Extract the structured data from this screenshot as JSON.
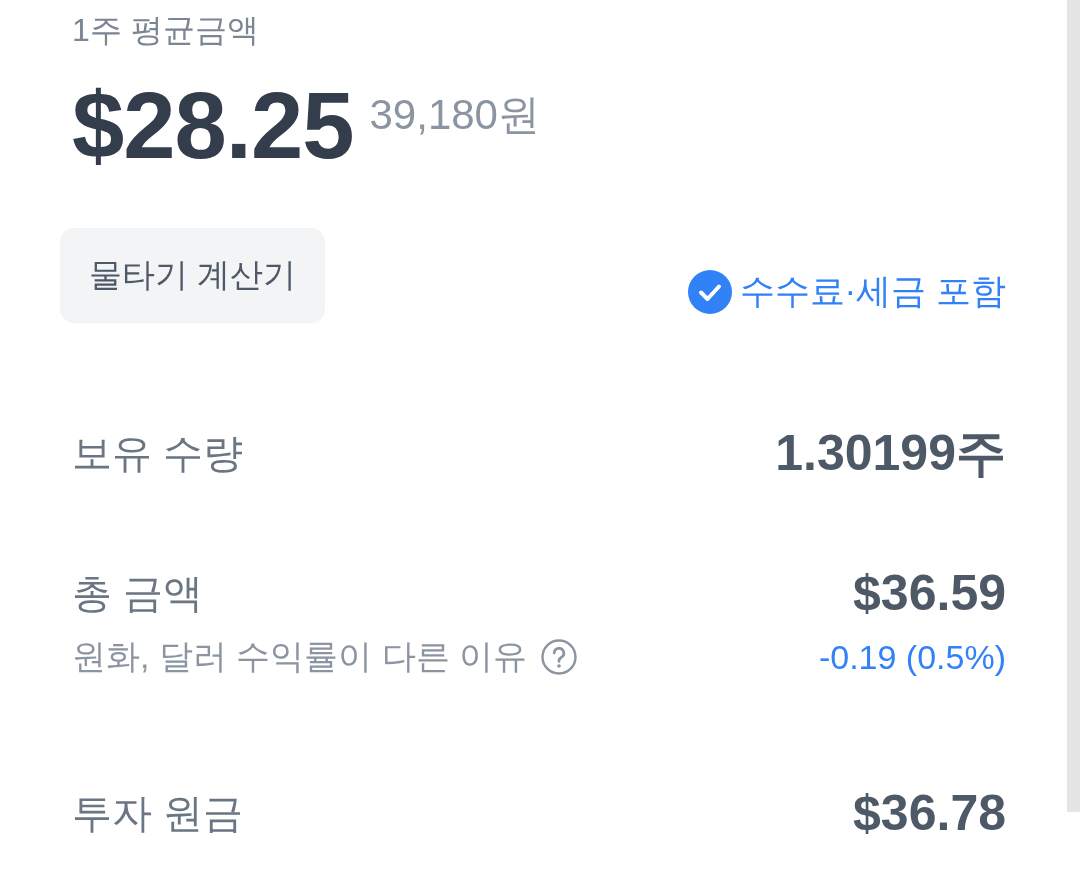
{
  "header": {
    "label": "1주 평균금액",
    "price_usd": "$28.25",
    "price_krw": "39,180원"
  },
  "calculator_button": {
    "label": "물타기 계산기"
  },
  "fee_toggle": {
    "label": "수수료·세금 포함",
    "checked": true
  },
  "rows": [
    {
      "label": "보유 수량",
      "value": "1.30199주"
    },
    {
      "label": "총 금액",
      "value": "$36.59",
      "note": "원화, 달러 수익률이 다른 이유",
      "change": "-0.19 (0.5%)"
    },
    {
      "label": "투자 원금",
      "value": "$36.78"
    }
  ]
}
